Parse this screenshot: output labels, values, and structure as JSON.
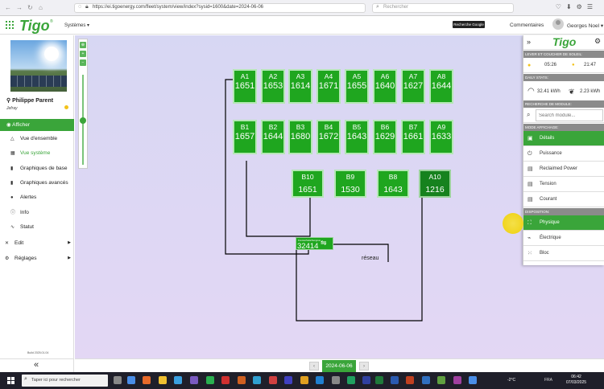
{
  "browser": {
    "url": "https://ei.tigoenergy.com/fleet/system/view/index?sysid=1600&date=2024-06-06",
    "search_placeholder": "Rechercher"
  },
  "header": {
    "logo": "Tigo",
    "systems_label": "Systèmes",
    "google_search_button": "Recherche Google",
    "comments_link": "Commentaires",
    "user_name": "Georges Noel"
  },
  "sidebar": {
    "site_name": "Philippe Parent",
    "site_location": "Jefray",
    "active_section": "Afficher",
    "items": [
      {
        "label": "Vue d'ensemble",
        "icon": "warning-triangle-icon"
      },
      {
        "label": "Vue système",
        "icon": "solar-panel-icon"
      },
      {
        "label": "Graphiques de base",
        "icon": "bar-chart-icon"
      },
      {
        "label": "Graphiques avancés",
        "icon": "advanced-chart-icon"
      },
      {
        "label": "Alertes",
        "icon": "alert-icon"
      },
      {
        "label": "Info",
        "icon": "info-icon"
      },
      {
        "label": "Statut",
        "icon": "pulse-icon"
      }
    ],
    "edit_label": "Edit",
    "settings_label": "Réglages",
    "build": "Build 2025.01.04"
  },
  "modules": {
    "row_a": [
      {
        "id": "A1",
        "value": "1651"
      },
      {
        "id": "A2",
        "value": "1653"
      },
      {
        "id": "A3",
        "value": "1614"
      },
      {
        "id": "A4",
        "value": "1671"
      },
      {
        "id": "A5",
        "value": "1655"
      },
      {
        "id": "A6",
        "value": "1640"
      },
      {
        "id": "A7",
        "value": "1627"
      },
      {
        "id": "A8",
        "value": "1644"
      }
    ],
    "row_b": [
      {
        "id": "B1",
        "value": "1657"
      },
      {
        "id": "B2",
        "value": "1644"
      },
      {
        "id": "B3",
        "value": "1680"
      },
      {
        "id": "B4",
        "value": "1672"
      },
      {
        "id": "B5",
        "value": "1643"
      },
      {
        "id": "B6",
        "value": "1629"
      },
      {
        "id": "B7",
        "value": "1661"
      },
      {
        "id": "A9",
        "value": "1633"
      }
    ],
    "row_c": [
      {
        "id": "B10",
        "value": "1651"
      },
      {
        "id": "B9",
        "value": "1530"
      },
      {
        "id": "B8",
        "value": "1643"
      },
      {
        "id": "A10",
        "value": "1216"
      }
    ]
  },
  "inverter": {
    "brand": "Fronius/Solis/Sungrow",
    "value": "32414"
  },
  "grid_label": "réseau",
  "right_panel": {
    "logo": "Tigo",
    "sunrise_title": "Lever et coucher de soleil:",
    "sunrise": "05:26",
    "sunset": "21:47",
    "daily_title": "Daily stats:",
    "daily_energy": "32.41 kWh",
    "daily_reclaimed": "2.23 kWh",
    "module_search_title": "Recherche de module:",
    "module_search_placeholder": "Search module...",
    "display_mode_title": "Mode affichage:",
    "display_modes": [
      "Détails",
      "Puissance",
      "Reclaimed Power",
      "Tension",
      "Courant"
    ],
    "layout_title": "Disposition:",
    "layouts": [
      "Physique",
      "Électrique",
      "Bloc"
    ]
  },
  "date_nav": {
    "current": "2024-06-06"
  },
  "taskbar": {
    "search_placeholder": "Taper ici pour rechercher",
    "weather": "-2°C",
    "lang": "FRA",
    "time": "06:42",
    "date": "07/03/2025"
  },
  "colors": {
    "accent": "#3aa53a",
    "module": "#1fa61f",
    "canvas": "#dcd6f4"
  }
}
